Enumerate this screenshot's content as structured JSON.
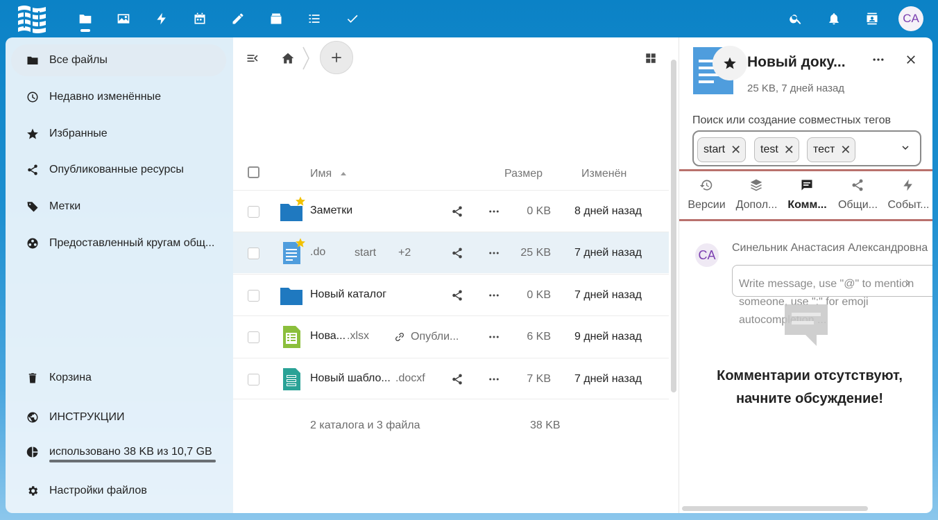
{
  "header": {
    "avatar_initials": "CA",
    "apps": [
      "files-icon",
      "photos-icon",
      "activity-icon",
      "calendar-icon",
      "notes-icon",
      "deck-icon",
      "lists-icon",
      "tasks-icon"
    ],
    "right_icons": [
      "search-icon",
      "bell-icon",
      "contacts-icon"
    ]
  },
  "nav": {
    "items": [
      {
        "label": "Все файлы",
        "icon": "folder-icon",
        "active": true
      },
      {
        "label": "Недавно изменённые",
        "icon": "clock-icon"
      },
      {
        "label": "Избранные",
        "icon": "star-icon"
      },
      {
        "label": "Опубликованные ресурсы",
        "icon": "share-icon"
      },
      {
        "label": "Метки",
        "icon": "tag-icon"
      },
      {
        "label": "Предоставленный кругам общ...",
        "icon": "circles-icon"
      }
    ],
    "bottom": [
      {
        "label": "Корзина",
        "icon": "trash-icon"
      },
      {
        "label": "ИНСТРУКЦИИ",
        "icon": "globe-icon"
      },
      {
        "label": "использовано 38 KB из 10,7 GB",
        "icon": "pie-icon"
      },
      {
        "label": "Настройки файлов",
        "icon": "gear-icon"
      }
    ],
    "quota_fraction": 0.0
  },
  "list": {
    "col_name": "Имя",
    "col_size": "Размер",
    "col_modified": "Изменён",
    "rows": [
      {
        "name": "Заметки",
        "ext": "",
        "size": "0 KB",
        "date": "8 дней назад",
        "type": "folder",
        "favorite": true
      },
      {
        "name": ".do",
        "ext": "",
        "tag": "start",
        "tag_more": "+2",
        "size": "25 KB",
        "date": "7 дней назад",
        "type": "doc",
        "favorite": true,
        "highlighted": true
      },
      {
        "name": "Новый каталог",
        "ext": "",
        "size": "0 KB",
        "date": "7 дней назад",
        "type": "folder"
      },
      {
        "name": "Нова...",
        "ext": ".xlsx",
        "shared_label": "Опубли...",
        "size": "6 KB",
        "date": "9 дней назад",
        "type": "sheet"
      },
      {
        "name": "Новый шабло...",
        "ext": ".docxf",
        "size": "7 KB",
        "date": "7 дней назад",
        "type": "form"
      }
    ],
    "summary": "2 каталога и 3 файла",
    "summary_size": "38 KB"
  },
  "sidebar": {
    "title": "Новый доку...",
    "subtitle": "25 KB, 7 дней назад",
    "tags_label": "Поиск или создание совместных тегов",
    "tags": [
      "start",
      "test",
      "тест"
    ],
    "tabs": [
      {
        "label": "Версии",
        "icon": "history-icon"
      },
      {
        "label": "Допол...",
        "icon": "layers-icon"
      },
      {
        "label": "Комм...",
        "icon": "comment-icon",
        "active": true
      },
      {
        "label": "Общи...",
        "icon": "share-icon"
      },
      {
        "label": "Событ...",
        "icon": "activity-icon"
      }
    ],
    "comment_author": "Синельник Анастасия Александровна",
    "comment_avatar": "CA",
    "comment_placeholder": "Write message, use \"@\" to mention someone, use \":\" for emoji autocompletion ...",
    "empty_text": "Комментарии отсутствуют, начните обсуждение!"
  }
}
